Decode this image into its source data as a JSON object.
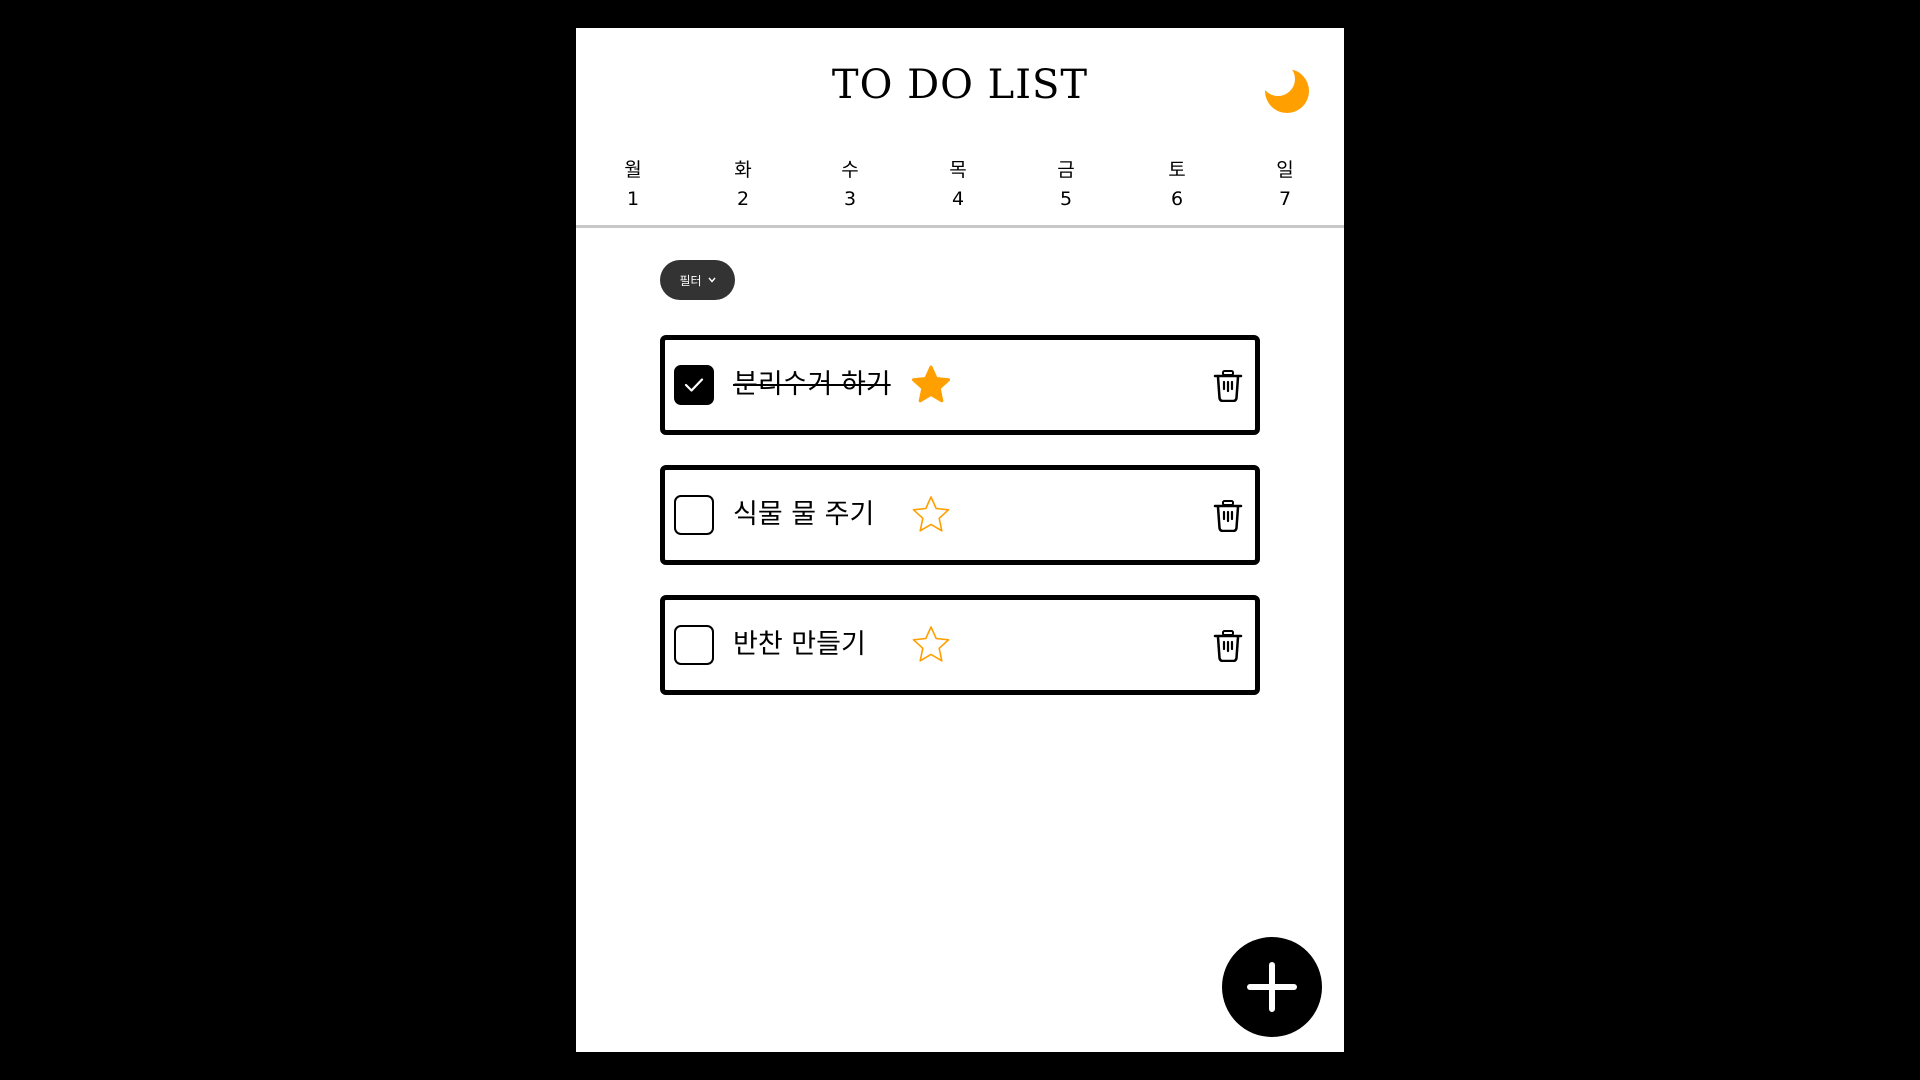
{
  "app": {
    "title": "TO DO LIST",
    "theme_toggle_icon": "moon-icon",
    "accent_color": "#FF9F00"
  },
  "week": [
    {
      "name": "월",
      "date": "1"
    },
    {
      "name": "화",
      "date": "2"
    },
    {
      "name": "수",
      "date": "3"
    },
    {
      "name": "목",
      "date": "4"
    },
    {
      "name": "금",
      "date": "5"
    },
    {
      "name": "토",
      "date": "6"
    },
    {
      "name": "일",
      "date": "7"
    }
  ],
  "filter": {
    "label": "필터",
    "icon": "chevron-down-icon"
  },
  "todos": [
    {
      "text": "분리수거 하기",
      "done": true,
      "starred": true
    },
    {
      "text": "식물 물 주기",
      "done": false,
      "starred": false
    },
    {
      "text": "반찬 만들기",
      "done": false,
      "starred": false
    }
  ],
  "actions": {
    "add_icon": "plus-icon",
    "delete_icon": "trash-icon"
  }
}
